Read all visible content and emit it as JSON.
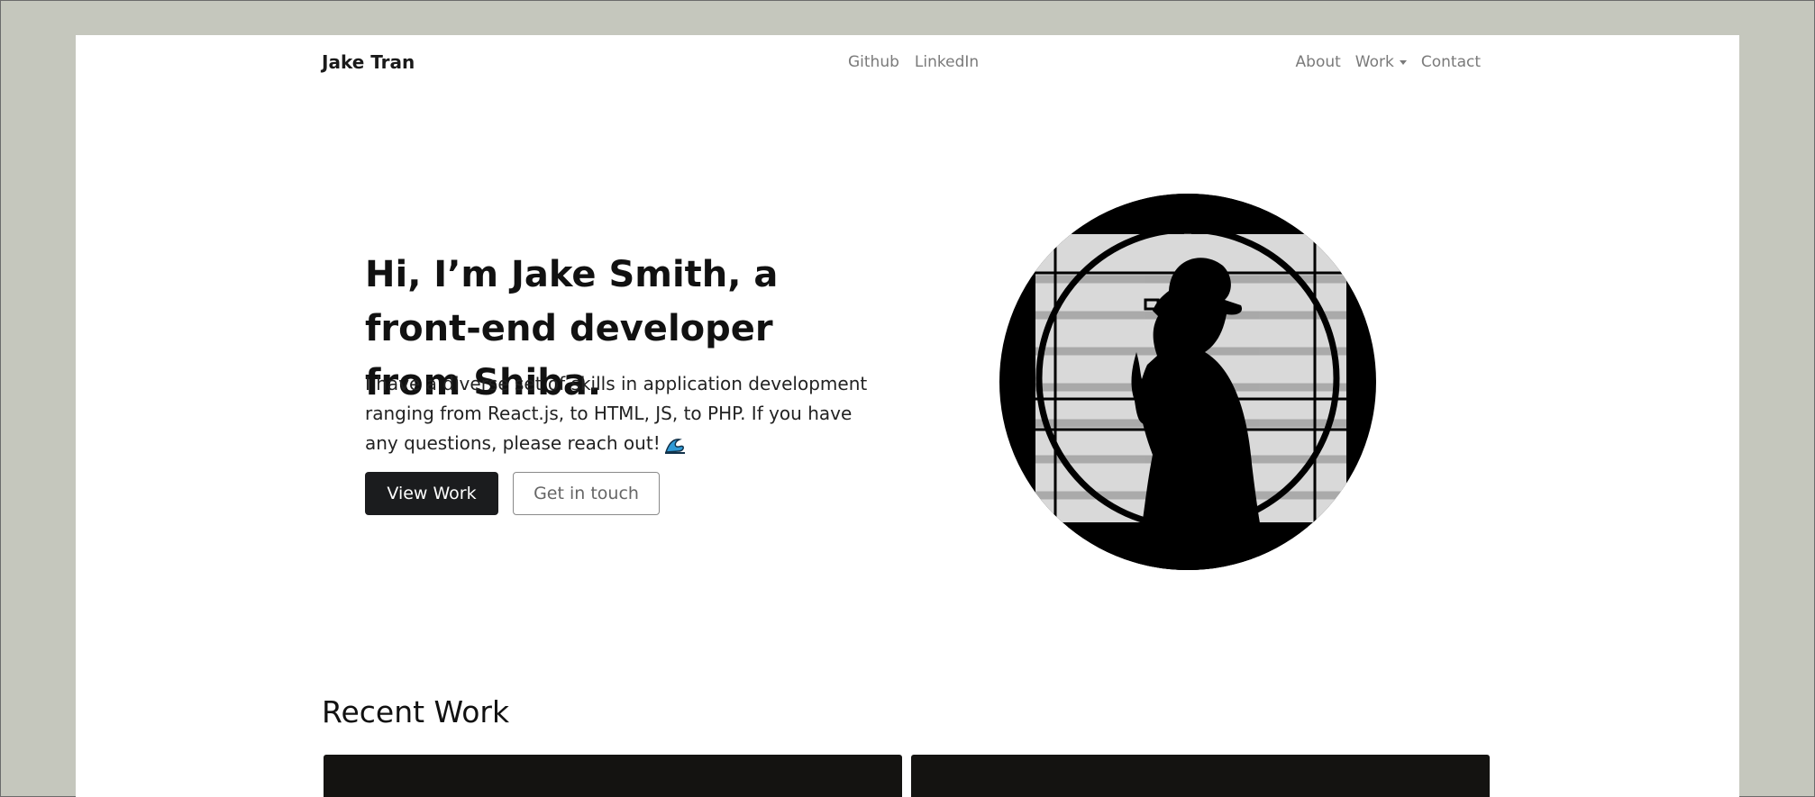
{
  "nav": {
    "brand": "Jake Tran",
    "center_links": [
      "Github",
      "LinkedIn"
    ],
    "right_links": {
      "about": "About",
      "work": "Work",
      "contact": "Contact"
    }
  },
  "hero": {
    "title": "Hi, I’m Jake Smith, a front-end developer from Shiba.",
    "text": "I have a diverse set of skills in application development ranging from React.js, to HTML, JS, to PHP. If you have any questions, please reach out!",
    "wave_icon": "wave-icon",
    "primary_button": "View Work",
    "secondary_button": "Get in touch"
  },
  "recent_work": {
    "title": "Recent Work"
  },
  "colors": {
    "background": "#c5c7bd",
    "page": "#ffffff",
    "primary_button": "#1b1c1e",
    "card": "#141311"
  }
}
